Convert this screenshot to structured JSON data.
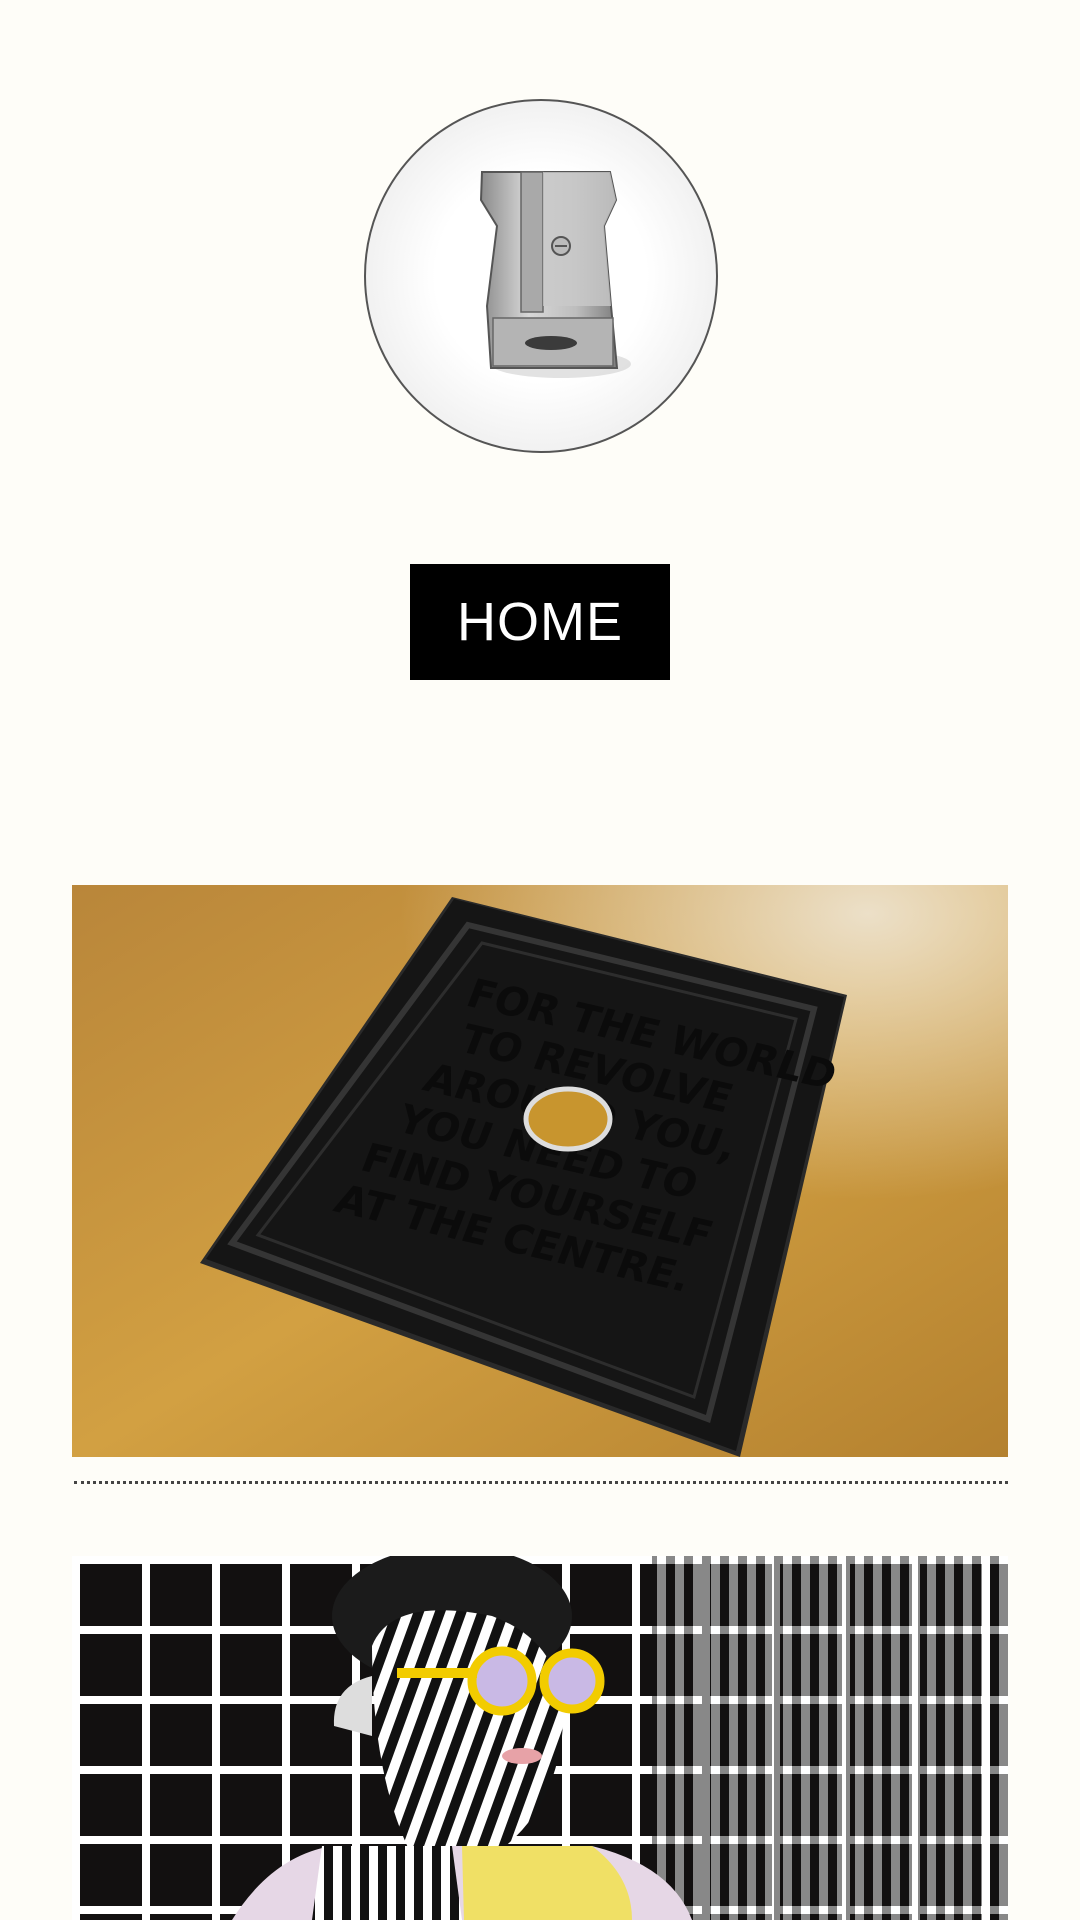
{
  "logo": {
    "icon": "pencil-sharpener-icon"
  },
  "nav": {
    "home_label": "HOME"
  },
  "gallery": {
    "items": [
      {
        "type": "image",
        "description_icon": "book-cover-image",
        "cover_text": [
          "FOR THE WORLD",
          "TO REVOLVE",
          "AROUND YOU,",
          "YOU NEED TO",
          "FIND YOURSELF",
          "AT THE CENTRE."
        ]
      },
      {
        "type": "image",
        "description_icon": "pop-art-portrait-image"
      }
    ]
  },
  "colors": {
    "background": "#fefdf8",
    "button_bg": "#000000",
    "button_text": "#ffffff",
    "floor": "#c8952e",
    "book": "#161616"
  }
}
